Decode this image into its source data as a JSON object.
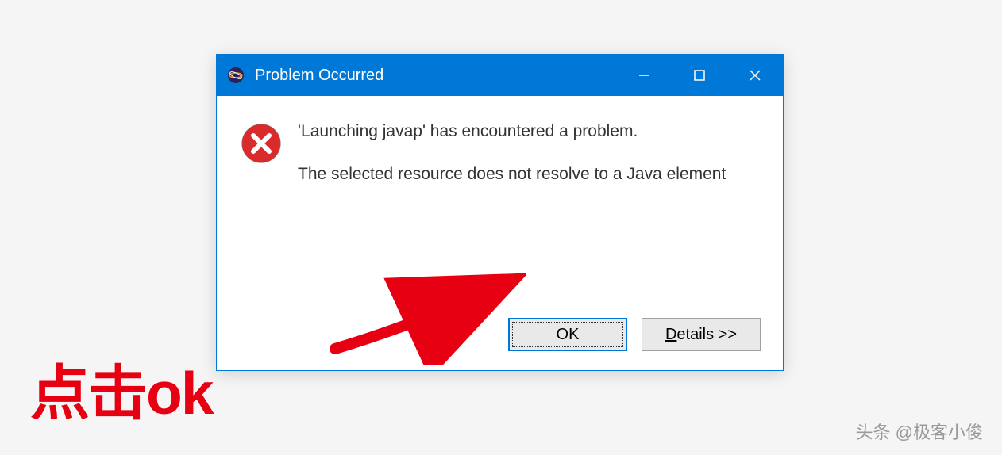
{
  "dialog": {
    "title": "Problem Occurred",
    "main_message": "'Launching javap' has encountered a problem.",
    "detail_message": "The selected resource does not resolve to a Java element",
    "buttons": {
      "ok": "OK",
      "details": "Details >>"
    }
  },
  "annotation": {
    "text": "点击ok"
  },
  "watermark": "头条 @极客小俊",
  "icons": {
    "app": "eclipse-icon",
    "error": "error-icon",
    "minimize": "minimize-icon",
    "maximize": "maximize-icon",
    "close": "close-icon"
  }
}
